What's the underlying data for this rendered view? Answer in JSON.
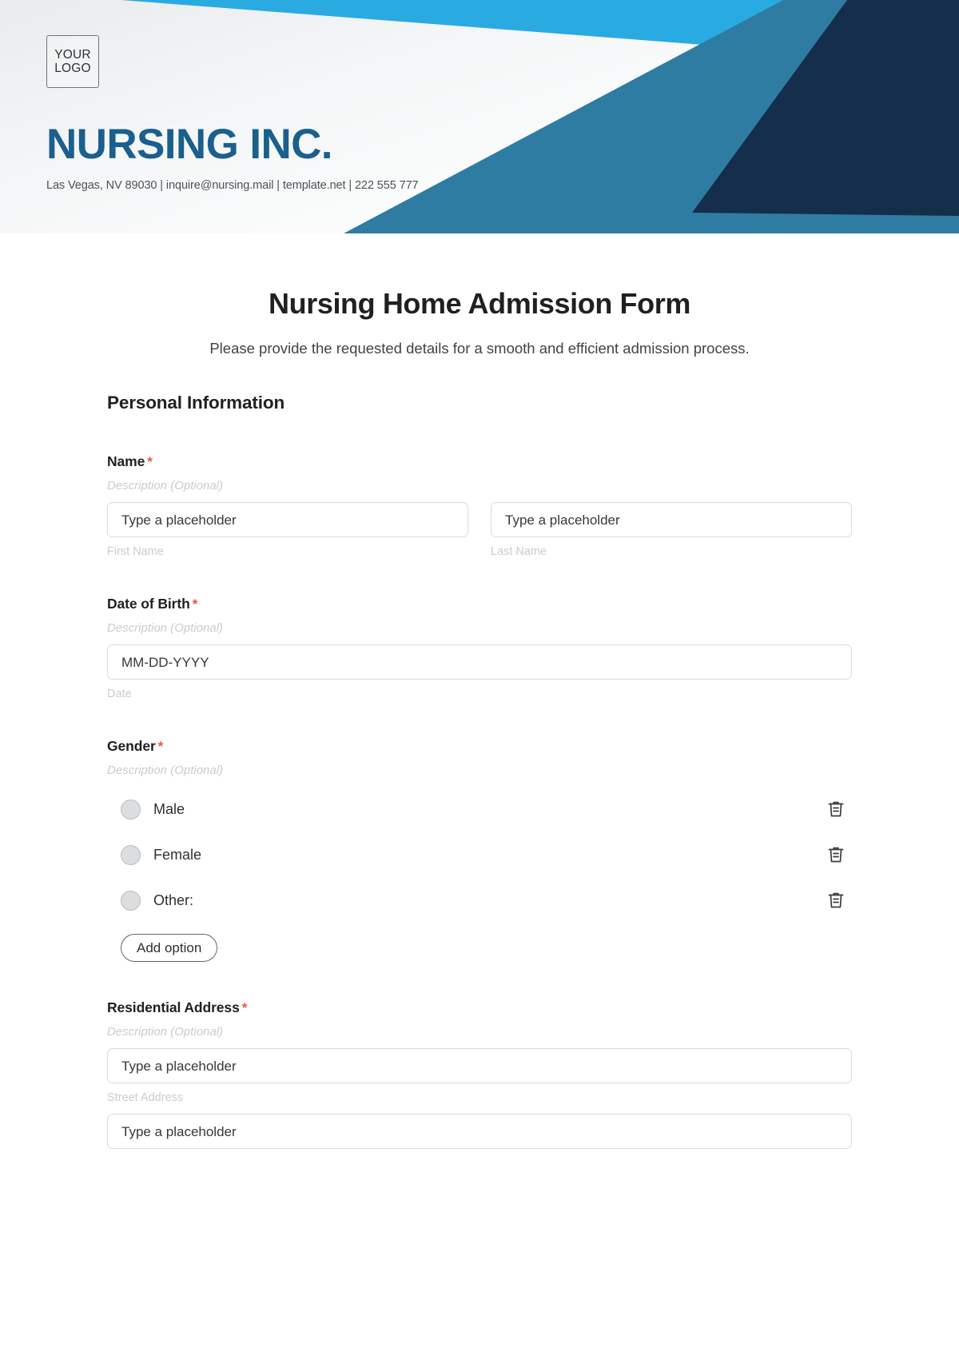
{
  "banner": {
    "logo_line1": "YOUR",
    "logo_line2": "LOGO",
    "company_name": "NURSING INC.",
    "contact": "Las Vegas, NV 89030 | inquire@nursing.mail | template.net | 222 555 777",
    "colors": {
      "cyan": "#29ABE2",
      "steel_blue": "#2F7CA3",
      "navy": "#142E4C",
      "paper": "#F2F4F5",
      "brand_text": "#1B5F8C"
    }
  },
  "form": {
    "title": "Nursing Home Admission Form",
    "subtitle": "Please provide the requested details for a smooth and efficient admission process.",
    "section_heading": "Personal Information",
    "required_marker": "*",
    "description_placeholder": "Description (Optional)",
    "fields": {
      "name": {
        "label": "Name",
        "description": "Description (Optional)",
        "first": {
          "value": "Type a placeholder",
          "sub_label": "First Name"
        },
        "last": {
          "value": "Type a placeholder",
          "sub_label": "Last Name"
        }
      },
      "dob": {
        "label": "Date of Birth",
        "description": "Description (Optional)",
        "value": "MM-DD-YYYY",
        "sub_label": "Date"
      },
      "gender": {
        "label": "Gender",
        "description": "Description (Optional)",
        "options": [
          {
            "label": "Male",
            "delete_icon": "trash-icon"
          },
          {
            "label": "Female",
            "delete_icon": "trash-icon"
          },
          {
            "label": "Other:",
            "delete_icon": "trash-icon"
          }
        ],
        "add_option_label": "Add option"
      },
      "address": {
        "label": "Residential Address",
        "description": "Description (Optional)",
        "street": {
          "value": "Type a placeholder",
          "sub_label": "Street Address"
        },
        "line2": {
          "value": "Type a placeholder"
        }
      }
    }
  }
}
